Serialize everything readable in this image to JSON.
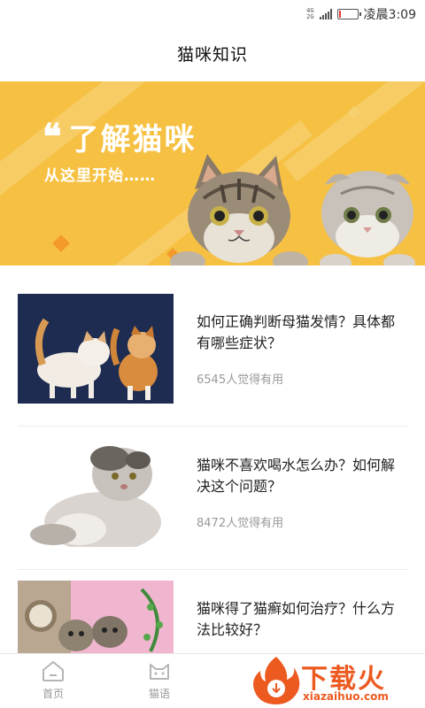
{
  "status_bar": {
    "network_top": "4G",
    "network_bottom": "2G",
    "time": "凌晨3:09",
    "battery_level": 0.12,
    "battery_color": "#e53935"
  },
  "header": {
    "title": "猫咪知识"
  },
  "banner": {
    "quote_mark": "❝",
    "title": "了解猫咪",
    "subtitle": "从这里开始……",
    "background": "#f6c143"
  },
  "articles": [
    {
      "title": "如何正确判断母猫发情？具体都有哪些症状？",
      "meta": "6545人觉得有用"
    },
    {
      "title": "猫咪不喜欢喝水怎么办？如何解决这个问题？",
      "meta": "8472人觉得有用"
    },
    {
      "title": "猫咪得了猫癣如何治疗？什么方法比较好？",
      "meta": ""
    }
  ],
  "nav": {
    "items": [
      {
        "label": "首页",
        "icon": "home-icon"
      },
      {
        "label": "猫语",
        "icon": "cat-face-icon"
      }
    ]
  },
  "watermark": {
    "text": "下载火",
    "url": "xiazaihuo.com",
    "color": "#ec5a20"
  }
}
